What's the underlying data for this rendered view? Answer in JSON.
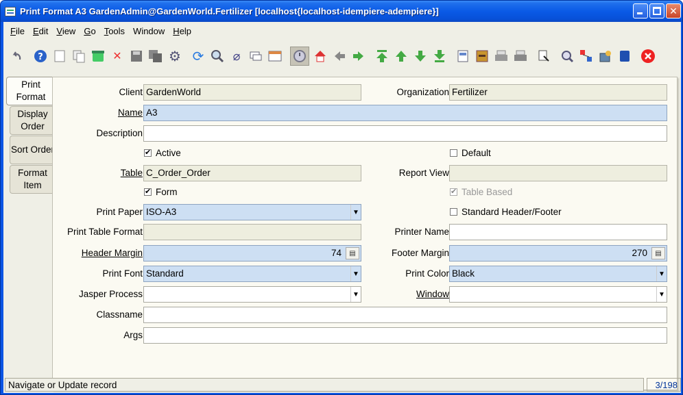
{
  "window": {
    "title": "Print Format  A3  GardenAdmin@GardenWorld.Fertilizer [localhost{localhost-idempiere-adempiere}]"
  },
  "menu": [
    {
      "key": "F",
      "rest": "ile"
    },
    {
      "key": "E",
      "rest": "dit"
    },
    {
      "key": "V",
      "rest": "iew"
    },
    {
      "key": "G",
      "rest": "o"
    },
    {
      "key": "T",
      "rest": "ools"
    },
    {
      "key": "W",
      "rest": "indow",
      "plain": "Window"
    },
    {
      "key": "H",
      "rest": "elp"
    }
  ],
  "tabs": [
    "Print Format",
    "Display Order",
    "Sort Order",
    "Format Item"
  ],
  "form": {
    "client_label": "Client",
    "client_value": "GardenWorld",
    "org_label": "Organization",
    "org_value": "Fertilizer",
    "name_label": "Name",
    "name_value": "A3",
    "description_label": "Description",
    "description_value": "",
    "active_label": "Active",
    "active_checked": "✔",
    "default_label": "Default",
    "default_checked": "",
    "table_label": "Table",
    "table_value": "C_Order_Order",
    "reportview_label": "Report View",
    "reportview_value": "",
    "form_label": "Form",
    "form_checked": "✔",
    "tablebased_label": "Table Based",
    "tablebased_checked": "✔",
    "printpaper_label": "Print Paper",
    "printpaper_value": "ISO-A3",
    "stdheader_label": "Standard Header/Footer",
    "stdheader_checked": "",
    "printtable_label": "Print Table Format",
    "printtable_value": "",
    "printername_label": "Printer Name",
    "printername_value": "",
    "headermargin_label": "Header Margin",
    "headermargin_value": "74",
    "footermargin_label": "Footer Margin",
    "footermargin_value": "270",
    "printfont_label": "Print Font",
    "printfont_value": "Standard",
    "printcolor_label": "Print Color",
    "printcolor_value": "Black",
    "jasper_label": "Jasper Process",
    "jasper_value": "",
    "window_label": "Window",
    "window_value": "",
    "classname_label": "Classname",
    "classname_value": "",
    "args_label": "Args",
    "args_value": ""
  },
  "status": {
    "message": "Navigate or Update record",
    "count": "3/198"
  },
  "colors": {
    "mandatory": "#cddff3",
    "readonly": "#eeeedf",
    "titlebar": "#0a5ae6"
  }
}
